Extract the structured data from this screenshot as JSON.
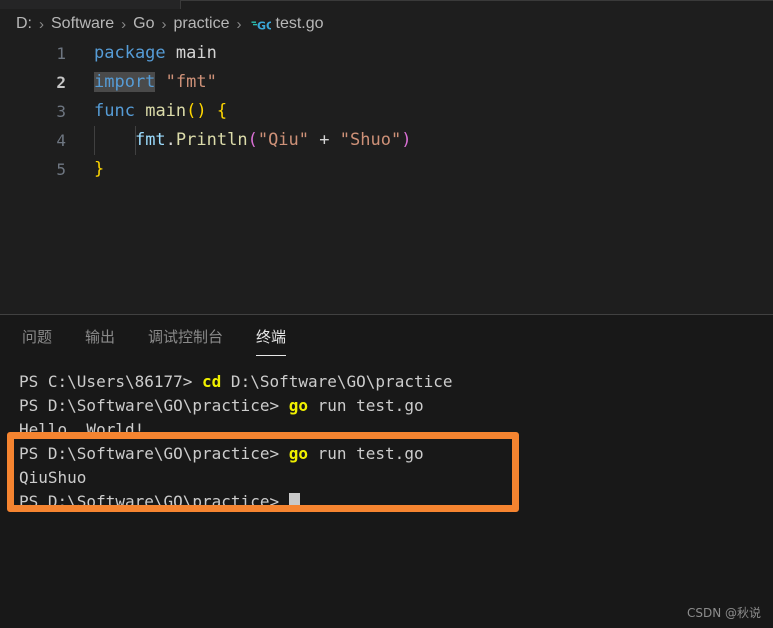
{
  "breadcrumb": {
    "separator": "›",
    "items": [
      {
        "label": "D:",
        "icon": null
      },
      {
        "label": "Software",
        "icon": null
      },
      {
        "label": "Go",
        "icon": null
      },
      {
        "label": "practice",
        "icon": null
      },
      {
        "label": "test.go",
        "icon": "go-file-icon"
      }
    ]
  },
  "editor": {
    "language": "go",
    "active_line": 2,
    "lines": [
      {
        "number": "1",
        "tokens": [
          {
            "text": "package",
            "kind": "keyword"
          },
          {
            "text": " ",
            "kind": "plain"
          },
          {
            "text": "main",
            "kind": "identifier"
          }
        ]
      },
      {
        "number": "2",
        "tokens": [
          {
            "text": "import",
            "kind": "keyword-selected"
          },
          {
            "text": " ",
            "kind": "plain"
          },
          {
            "text": "\"fmt\"",
            "kind": "string"
          }
        ]
      },
      {
        "number": "3",
        "tokens": [
          {
            "text": "func",
            "kind": "keyword"
          },
          {
            "text": " ",
            "kind": "plain"
          },
          {
            "text": "main",
            "kind": "function"
          },
          {
            "text": "()",
            "kind": "brace"
          },
          {
            "text": " ",
            "kind": "plain"
          },
          {
            "text": "{",
            "kind": "brace"
          }
        ]
      },
      {
        "number": "4",
        "tokens": [
          {
            "text": "    ",
            "kind": "plain"
          },
          {
            "text": "fmt",
            "kind": "package"
          },
          {
            "text": ".",
            "kind": "dot"
          },
          {
            "text": "Println",
            "kind": "function"
          },
          {
            "text": "(",
            "kind": "paren"
          },
          {
            "text": "\"Qiu\"",
            "kind": "string"
          },
          {
            "text": " ",
            "kind": "plain"
          },
          {
            "text": "+",
            "kind": "operator"
          },
          {
            "text": " ",
            "kind": "plain"
          },
          {
            "text": "\"Shuo\"",
            "kind": "string"
          },
          {
            "text": ")",
            "kind": "paren"
          }
        ]
      },
      {
        "number": "5",
        "tokens": [
          {
            "text": "}",
            "kind": "brace"
          }
        ]
      }
    ]
  },
  "panel": {
    "tabs": [
      {
        "label": "问题",
        "active": false
      },
      {
        "label": "输出",
        "active": false
      },
      {
        "label": "调试控制台",
        "active": false
      },
      {
        "label": "终端",
        "active": true
      }
    ]
  },
  "terminal": {
    "lines": [
      {
        "segments": [
          {
            "text": "PS C:\\Users\\86177> ",
            "kind": "text"
          },
          {
            "text": "cd",
            "kind": "command"
          },
          {
            "text": " D:\\Software\\GO\\practice",
            "kind": "text"
          }
        ],
        "cursor": false
      },
      {
        "segments": [
          {
            "text": "PS D:\\Software\\GO\\practice> ",
            "kind": "text"
          },
          {
            "text": "go",
            "kind": "command"
          },
          {
            "text": " run test.go",
            "kind": "text"
          }
        ],
        "cursor": false
      },
      {
        "segments": [
          {
            "text": "Hello, World!",
            "kind": "text"
          }
        ],
        "cursor": false
      },
      {
        "segments": [
          {
            "text": "PS D:\\Software\\GO\\practice> ",
            "kind": "text"
          },
          {
            "text": "go",
            "kind": "command"
          },
          {
            "text": " run test.go",
            "kind": "text"
          }
        ],
        "cursor": false
      },
      {
        "segments": [
          {
            "text": "QiuShuo",
            "kind": "text"
          }
        ],
        "cursor": false
      },
      {
        "segments": [
          {
            "text": "PS D:\\Software\\GO\\practice> ",
            "kind": "text"
          }
        ],
        "cursor": true
      }
    ]
  },
  "annotation": {
    "type": "highlight-rectangle",
    "color": "#f58430"
  },
  "watermark": {
    "text": "CSDN @秋说"
  },
  "colors": {
    "editor_background": "#1e1e1e",
    "panel_background": "#181818",
    "keyword": "#569cd6",
    "string": "#ce9178",
    "function": "#dcdcaa",
    "brace": "#ffd700",
    "paren": "#da70d6",
    "package": "#9cdcfe",
    "terminal_command": "#f0f000",
    "terminal_text": "#cccccc",
    "annotation": "#f58430"
  }
}
